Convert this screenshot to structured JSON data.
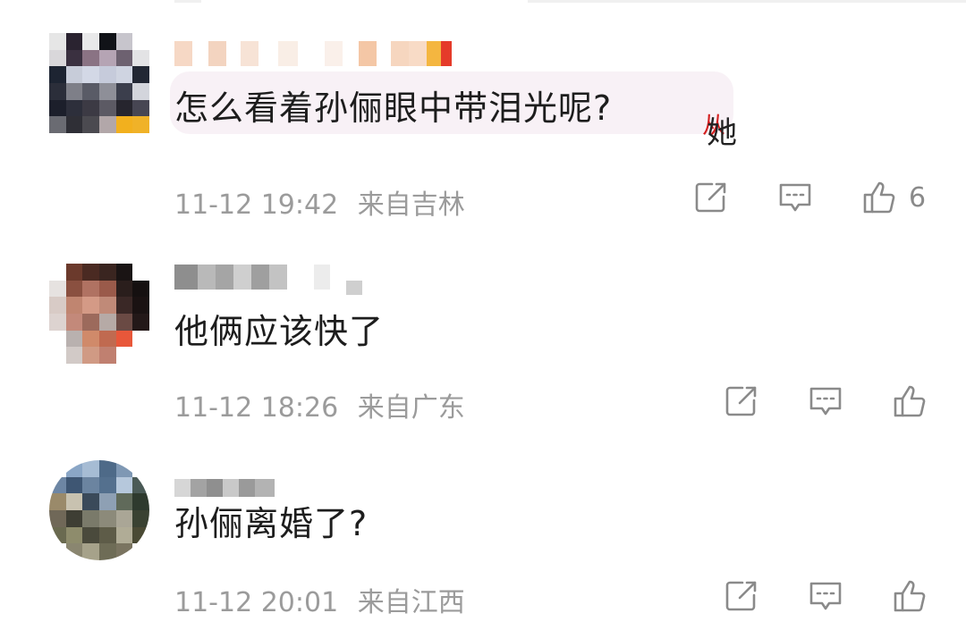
{
  "comments": [
    {
      "text": "怎么看着孙俪眼中带泪光呢?",
      "time": "11-12 19:42",
      "location": "来自吉林",
      "like_count": "6",
      "watermark": [
        "从",
        "她"
      ]
    },
    {
      "text": "他俩应该快了",
      "time": "11-12 18:26",
      "location": "来自广东",
      "like_count": ""
    },
    {
      "text": "孙俪离婚了?",
      "time": "11-12 20:01",
      "location": "来自江西",
      "like_count": ""
    }
  ],
  "icons": [
    "share-icon",
    "reply-icon",
    "like-icon"
  ],
  "colors": {
    "meta_text": "#9b9b9b",
    "icon": "#8a8a8a",
    "highlight_bubble": "#f8f1f6"
  }
}
